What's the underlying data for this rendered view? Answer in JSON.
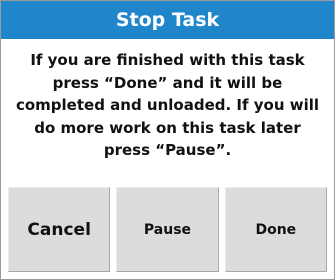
{
  "dialog": {
    "title": "Stop Task",
    "message_lines": [
      "If you are finished with this task",
      "press “Done” and it will be",
      "completed and unloaded. If you will",
      "do more work on this task later",
      "press “Pause”."
    ],
    "buttons": {
      "cancel": "Cancel",
      "pause": "Pause",
      "done": "Done"
    }
  },
  "colors": {
    "title_bar": "#1f86cc",
    "button_bg": "#dcdcdc"
  }
}
